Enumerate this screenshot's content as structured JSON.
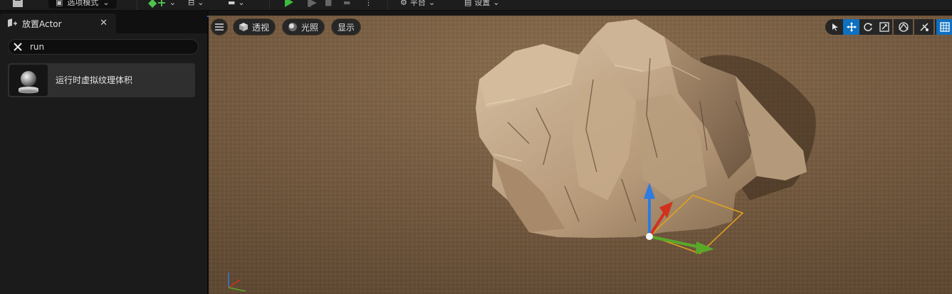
{
  "toolbar": {
    "mode_label": "选项模式",
    "platform_label": "平台",
    "settings_label": "设置"
  },
  "panel": {
    "tab_title": "放置Actor",
    "search": {
      "value": "run"
    },
    "results": [
      {
        "label": "运行时虚拟纹理体积",
        "icon": "sphere-on-pedestal-icon"
      }
    ]
  },
  "viewport": {
    "menu_icon": "hamburger-menu-icon",
    "view_mode_label": "透视",
    "lighting_label": "光照",
    "show_label": "显示",
    "accent_color": "#0e70c0",
    "gizmo_colors": {
      "x": "#d0321e",
      "y": "#5aa82a",
      "z": "#2f7be0",
      "plane": "#e0a020"
    },
    "right_tools": [
      "select-icon",
      "translate-icon",
      "rotate-icon",
      "scale-icon",
      "world-space-icon",
      "surface-snap-icon",
      "grid-snap-icon"
    ]
  }
}
